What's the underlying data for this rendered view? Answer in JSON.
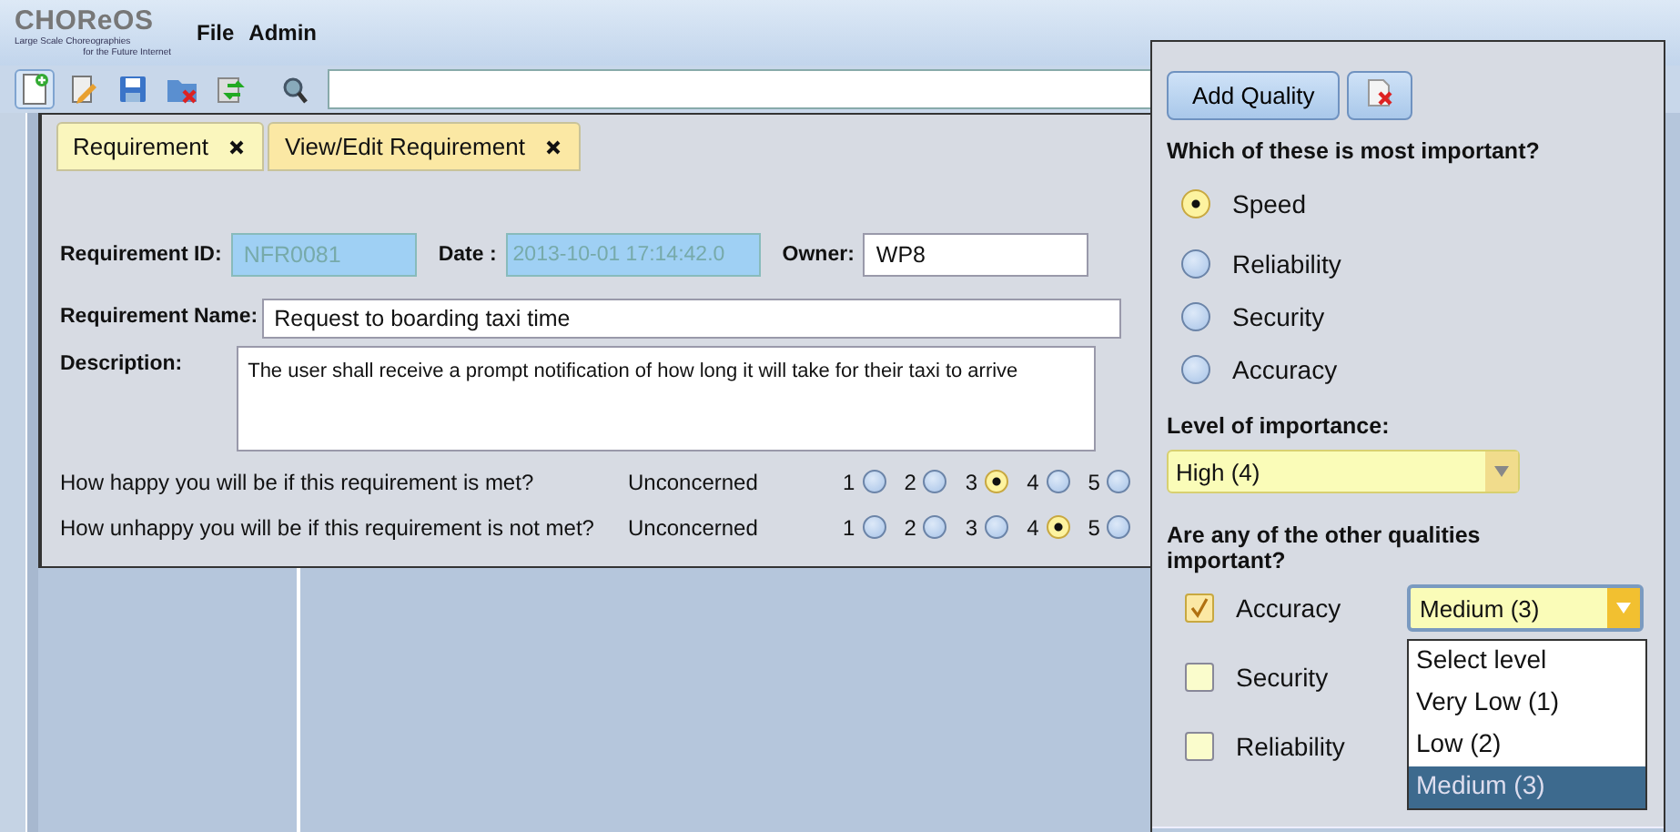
{
  "header": {
    "logo": {
      "name": "CHOReOS",
      "tagline": "Large Scale Choreographies",
      "subtitle": "for the Future Internet"
    },
    "menu": [
      "File",
      "Admin"
    ]
  },
  "tabs": [
    {
      "label": "Requirement",
      "selected": false
    },
    {
      "label": "View/Edit Requirement",
      "selected": true
    }
  ],
  "form": {
    "fields": [
      {
        "label": "Requirement ID:",
        "value": "NFR0081",
        "disabled": true
      },
      {
        "label": "Date :",
        "value": "2013-10-01 17:14:42.0",
        "disabled": true
      },
      {
        "label": "Owner:",
        "value": "WP8",
        "disabled": false
      }
    ],
    "name": {
      "label": "Requirement Name:",
      "value": "Request to boarding taxi time"
    },
    "description": {
      "label": "Description:",
      "value": "The user shall receive a prompt notification of how long it will take for their taxi to arrive"
    },
    "ratings": [
      {
        "question": "How happy you will be if this requirement is met?",
        "scale_label": "Unconcerned",
        "options": [
          {
            "label": "1",
            "selected": false
          },
          {
            "label": "2",
            "selected": false
          },
          {
            "label": "3",
            "selected": true
          },
          {
            "label": "4",
            "selected": false
          },
          {
            "label": "5",
            "selected": false
          }
        ]
      },
      {
        "question": "How unhappy you will be if this requirement is not met?",
        "scale_label": "Unconcerned",
        "options": [
          {
            "label": "1",
            "selected": false
          },
          {
            "label": "2",
            "selected": false
          },
          {
            "label": "3",
            "selected": false
          },
          {
            "label": "4",
            "selected": true
          },
          {
            "label": "5",
            "selected": false
          }
        ]
      }
    ]
  },
  "quality_panel": {
    "add_button": "Add Quality",
    "main_question": "Which of these is most important?",
    "qualities": [
      {
        "label": "Speed",
        "selected": true
      },
      {
        "label": "Reliability",
        "selected": false
      },
      {
        "label": "Security",
        "selected": false
      },
      {
        "label": "Accuracy",
        "selected": false
      }
    ],
    "importance_label": "Level of importance:",
    "importance_value": "High (4)",
    "others_question": "Are any of the other qualities important?",
    "others": [
      {
        "label": "Accuracy",
        "checked": true,
        "level": "Medium (3)",
        "dropdown_open": true,
        "options": [
          {
            "label": "Select level",
            "selected": false
          },
          {
            "label": "Very Low (1)",
            "selected": false
          },
          {
            "label": "Low (2)",
            "selected": false
          },
          {
            "label": "Medium (3)",
            "selected": true
          }
        ]
      },
      {
        "label": "Security",
        "checked": false
      },
      {
        "label": "Reliability",
        "checked": false
      }
    ]
  }
}
